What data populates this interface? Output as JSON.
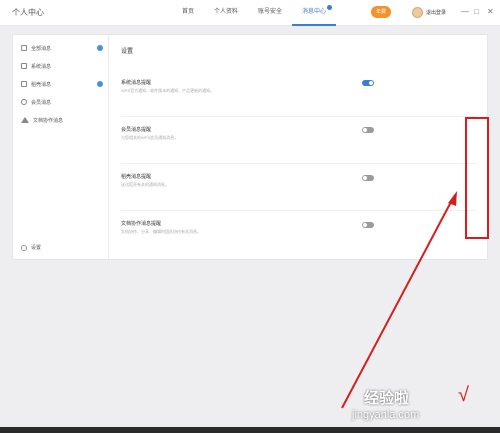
{
  "app": {
    "title": "个人中心"
  },
  "nav": {
    "tabs": [
      "首页",
      "个人资料",
      "账号安全",
      "消息中心"
    ]
  },
  "header": {
    "vip_label": "年费",
    "username": "退出登录"
  },
  "window": {
    "minimize": "—",
    "maximize": "□",
    "close": "✕"
  },
  "sidebar": {
    "items": [
      "全部消息",
      "系统消息",
      "稻壳消息",
      "会员消息",
      "文档协作消息"
    ],
    "settings_label": "设置"
  },
  "content": {
    "section_title": "设置",
    "settings": [
      {
        "title": "系统消息提醒",
        "desc": "WPS官方通知、软件版本的通知，产品更新的通知。",
        "enabled": true
      },
      {
        "title": "会员消息提醒",
        "desc": "与您相关的WPS会员通知消息。",
        "enabled": false
      },
      {
        "title": "稻壳消息提醒",
        "desc": "送达稻壳有关的通知消息。",
        "enabled": false
      },
      {
        "title": "文档协作消息提醒",
        "desc": "文档协作、分享、编辑时团队协作有关消息。",
        "enabled": false
      }
    ]
  },
  "watermark": {
    "text": "经验啦",
    "url": "jingyanla.com",
    "check": "√"
  },
  "colors": {
    "accent": "#3a7cdb",
    "highlight": "#d71d1d",
    "vip": "#f6922b"
  }
}
